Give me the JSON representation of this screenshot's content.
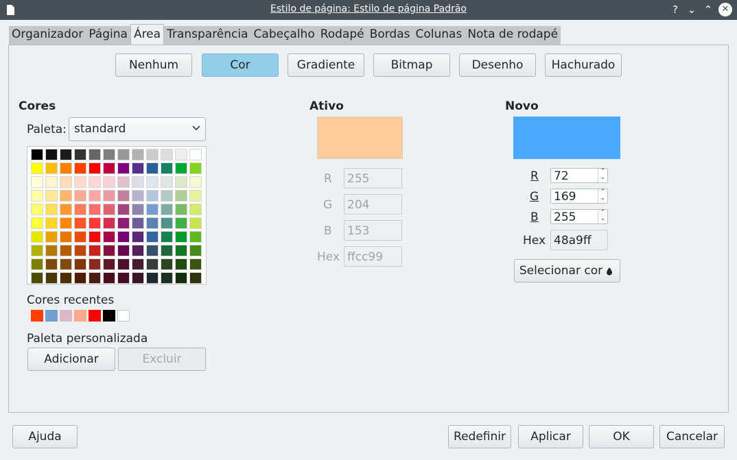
{
  "window": {
    "title": "Estilo de página: Estilo de página Padrão",
    "buttons": {
      "help": "?",
      "minimize": "⌄",
      "maximize": "⌃",
      "close": "✕"
    }
  },
  "tabs": [
    {
      "label": "Organizador",
      "active": false
    },
    {
      "label": "Página",
      "active": false
    },
    {
      "label": "Área",
      "active": true
    },
    {
      "label": "Transparência",
      "active": false
    },
    {
      "label": "Cabeçalho",
      "active": false
    },
    {
      "label": "Rodapé",
      "active": false
    },
    {
      "label": "Bordas",
      "active": false
    },
    {
      "label": "Colunas",
      "active": false
    },
    {
      "label": "Nota de rodapé",
      "active": false
    }
  ],
  "fill_types": {
    "none": "Nenhum",
    "color": "Cor",
    "gradient": "Gradiente",
    "bitmap": "Bitmap",
    "pattern": "Desenho",
    "hatch": "Hachurado",
    "selected": "Cor"
  },
  "colors": {
    "heading": "Cores",
    "palette_label": "Paleta:",
    "palette_value": "standard",
    "recent_label": "Cores recentes",
    "recent": [
      "#ff4000",
      "#729fcf",
      "#dbb8c6",
      "#ffa98d",
      "#ff0000",
      "#000000",
      "#ffffff"
    ],
    "custom_label": "Paleta personalizada",
    "add": "Adicionar",
    "delete": "Excluir",
    "grid": [
      [
        "#000000",
        "#111111",
        "#1c1c1c",
        "#333333",
        "#666666",
        "#808080",
        "#999999",
        "#b2b2b2",
        "#cccccc",
        "#dddddd",
        "#eeeeee",
        "#ffffff"
      ],
      [
        "#ffff00",
        "#ffbf00",
        "#ff8000",
        "#ff4000",
        "#ff0000",
        "#bf0041",
        "#800080",
        "#55308d",
        "#2a6099",
        "#158466",
        "#00a933",
        "#81d41a"
      ],
      [
        "#ffffd7",
        "#fff5ce",
        "#ffdbb6",
        "#ffd8ce",
        "#ffd7d7",
        "#f7d1d5",
        "#e0c2cd",
        "#dedce6",
        "#dee6ef",
        "#dee7e5",
        "#dde8cb",
        "#f6f9d4"
      ],
      [
        "#ffffa6",
        "#ffe994",
        "#ffb66c",
        "#ffaa95",
        "#ffa6a6",
        "#ec9ba4",
        "#bf819e",
        "#b7b3ca",
        "#b4c7dc",
        "#b3cac7",
        "#afd095",
        "#e8f2a1"
      ],
      [
        "#ffff6d",
        "#ffde59",
        "#ff972f",
        "#ff7b59",
        "#ff6d6d",
        "#e16173",
        "#a1467e",
        "#8e86ae",
        "#729fcf",
        "#81aca6",
        "#77bc65",
        "#d4ea6b"
      ],
      [
        "#ffff38",
        "#ffd428",
        "#ff860d",
        "#ff5429",
        "#ff3838",
        "#d62e4e",
        "#8d1d75",
        "#6b5e9b",
        "#5983b0",
        "#50938a",
        "#3faf46",
        "#c9e550"
      ],
      [
        "#e6e600",
        "#e8a202",
        "#ea7500",
        "#ed4c05",
        "#f10d0c",
        "#a7074b",
        "#780373",
        "#5b277d",
        "#3465a4",
        "#168253",
        "#069a2e",
        "#5eb91e"
      ],
      [
        "#b2b200",
        "#b47804",
        "#b85c00",
        "#be480a",
        "#c9211e",
        "#861141",
        "#650953",
        "#55215b",
        "#355269",
        "#1e6a39",
        "#127622",
        "#468a1a"
      ],
      [
        "#808000",
        "#814a08",
        "#824b0b",
        "#813709",
        "#8d281e",
        "#611729",
        "#4e102d",
        "#481d32",
        "#383d3c",
        "#28471f",
        "#224b12",
        "#395511"
      ],
      [
        "#4c4c00",
        "#4c3707",
        "#4c2d04",
        "#4c1d04",
        "#4c1b14",
        "#4b0d1e",
        "#460d27",
        "#3b1527",
        "#1d2b30",
        "#1b3020",
        "#172d10",
        "#2c330d"
      ]
    ]
  },
  "active": {
    "heading": "Ativo",
    "color": "#ffcc99",
    "r_label": "R",
    "r": "255",
    "g_label": "G",
    "g": "204",
    "b_label": "B",
    "b": "153",
    "hex_label": "Hex",
    "hex": "ffcc99"
  },
  "new": {
    "heading": "Novo",
    "color": "#48a9ff",
    "r_label": "R",
    "r": "72",
    "g_label": "G",
    "g": "169",
    "b_label": "B",
    "b": "255",
    "hex_label": "Hex",
    "hex": "48a9ff",
    "pick": "Selecionar cor"
  },
  "footer": {
    "help": "Ajuda",
    "reset": "Redefinir",
    "apply": "Aplicar",
    "ok": "OK",
    "cancel": "Cancelar"
  }
}
